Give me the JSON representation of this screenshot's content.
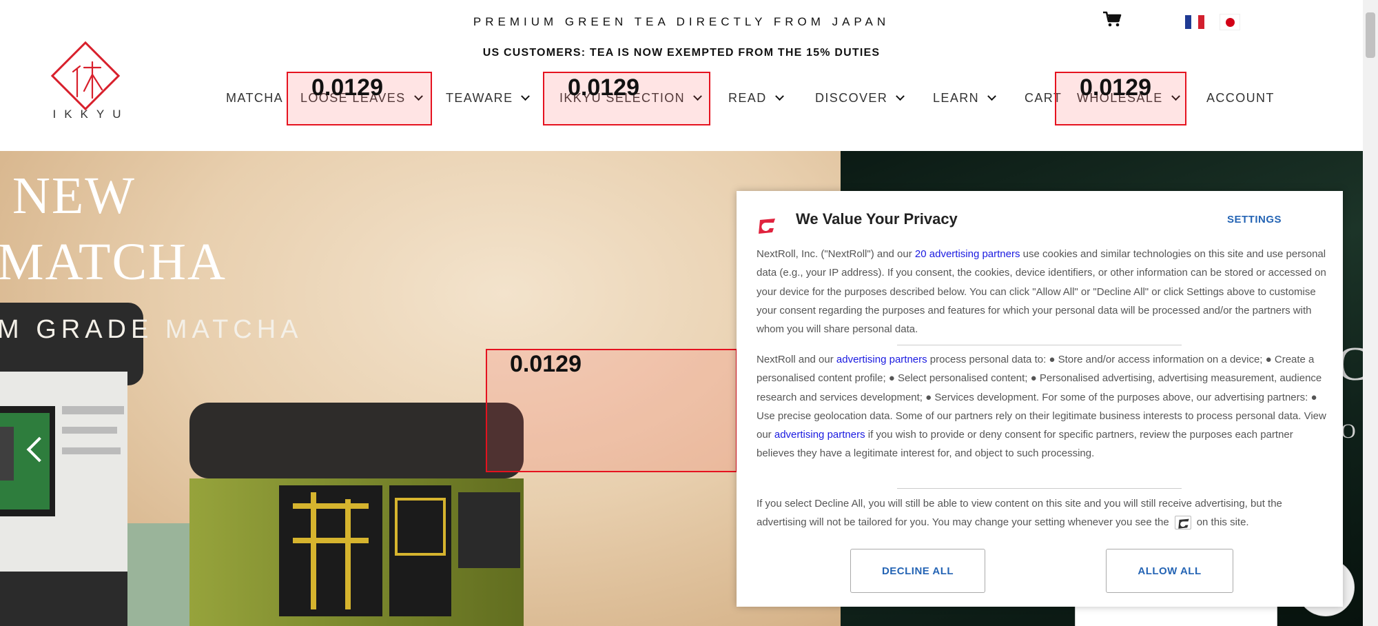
{
  "header": {
    "announcement_1": "PREMIUM GREEN TEA DIRECTLY FROM JAPAN",
    "announcement_2": "US CUSTOMERS: TEA IS NOW EXEMPTED FROM THE 15% DUTIES",
    "logo_text": "IKKYU",
    "cart_icon": "cart-icon",
    "languages": [
      "fr",
      "jp"
    ]
  },
  "nav": {
    "items": [
      {
        "label": "MATCHA",
        "dropdown": false
      },
      {
        "label": "LOOSE LEAVES",
        "dropdown": true
      },
      {
        "label": "TEAWARE",
        "dropdown": true
      },
      {
        "label": "IKKYU SELECTION",
        "dropdown": true
      },
      {
        "label": "READ",
        "dropdown": true
      },
      {
        "label": "DISCOVER",
        "dropdown": true
      },
      {
        "label": "LEARN",
        "dropdown": true
      },
      {
        "label": "CART",
        "dropdown": false
      },
      {
        "label": "WHOLESALE",
        "dropdown": true
      },
      {
        "label": "ACCOUNT",
        "dropdown": false
      }
    ]
  },
  "overlay_scores": {
    "loose_leaves": "0.0129",
    "ikkyu_selection": "0.0129",
    "wholesale": "0.0129",
    "hero": "0.0129"
  },
  "hero": {
    "line_1": "NEW",
    "line_2": "MATCHA",
    "line_3": "M GRADE MATCHA",
    "right_partial_1": "C",
    "right_partial_2": "O"
  },
  "cookie_modal": {
    "title": "We Value Your Privacy",
    "settings": "SETTINGS",
    "p1_a": "NextRoll, Inc. (\"NextRoll\") and our ",
    "p1_link": "20 advertising partners",
    "p1_b": " use cookies and similar technologies on this site and use personal data (e.g., your IP address). If you consent, the cookies, device identifiers, or other information can be stored or accessed on your device for the purposes described below. You can click \"Allow All\" or \"Decline All\" or click Settings above to customise your consent regarding the purposes and features for which your personal data will be processed and/or the partners with whom you will share personal data.",
    "p2_a": "NextRoll and our ",
    "p2_link": "advertising partners",
    "p2_b": " process personal data to: ● Store and/or access information on a device; ● Create a personalised content profile; ● Select personalised content; ● Personalised advertising, advertising measurement, audience research and services development; ● Services development. For some of the purposes above, our advertising partners: ● Use precise geolocation data. Some of our partners rely on their legitimate business interests to process personal data. View our ",
    "p2_link2": "advertising partners",
    "p2_c": " if you wish to provide or deny consent for specific partners, review the purposes each partner believes they have a legitimate interest for, and object to such processing.",
    "p3_a": "If you select Decline All, you will still be able to view content on this site and you will still receive advertising, but the advertising will not be tailored for you. You may change your setting whenever you see the",
    "p3_b": "on this site.",
    "decline": "DECLINE ALL",
    "allow": "ALLOW ALL",
    "accent_color": "#2464b4",
    "link_color": "#1a1ae0",
    "brand_color": "#e0233e"
  }
}
